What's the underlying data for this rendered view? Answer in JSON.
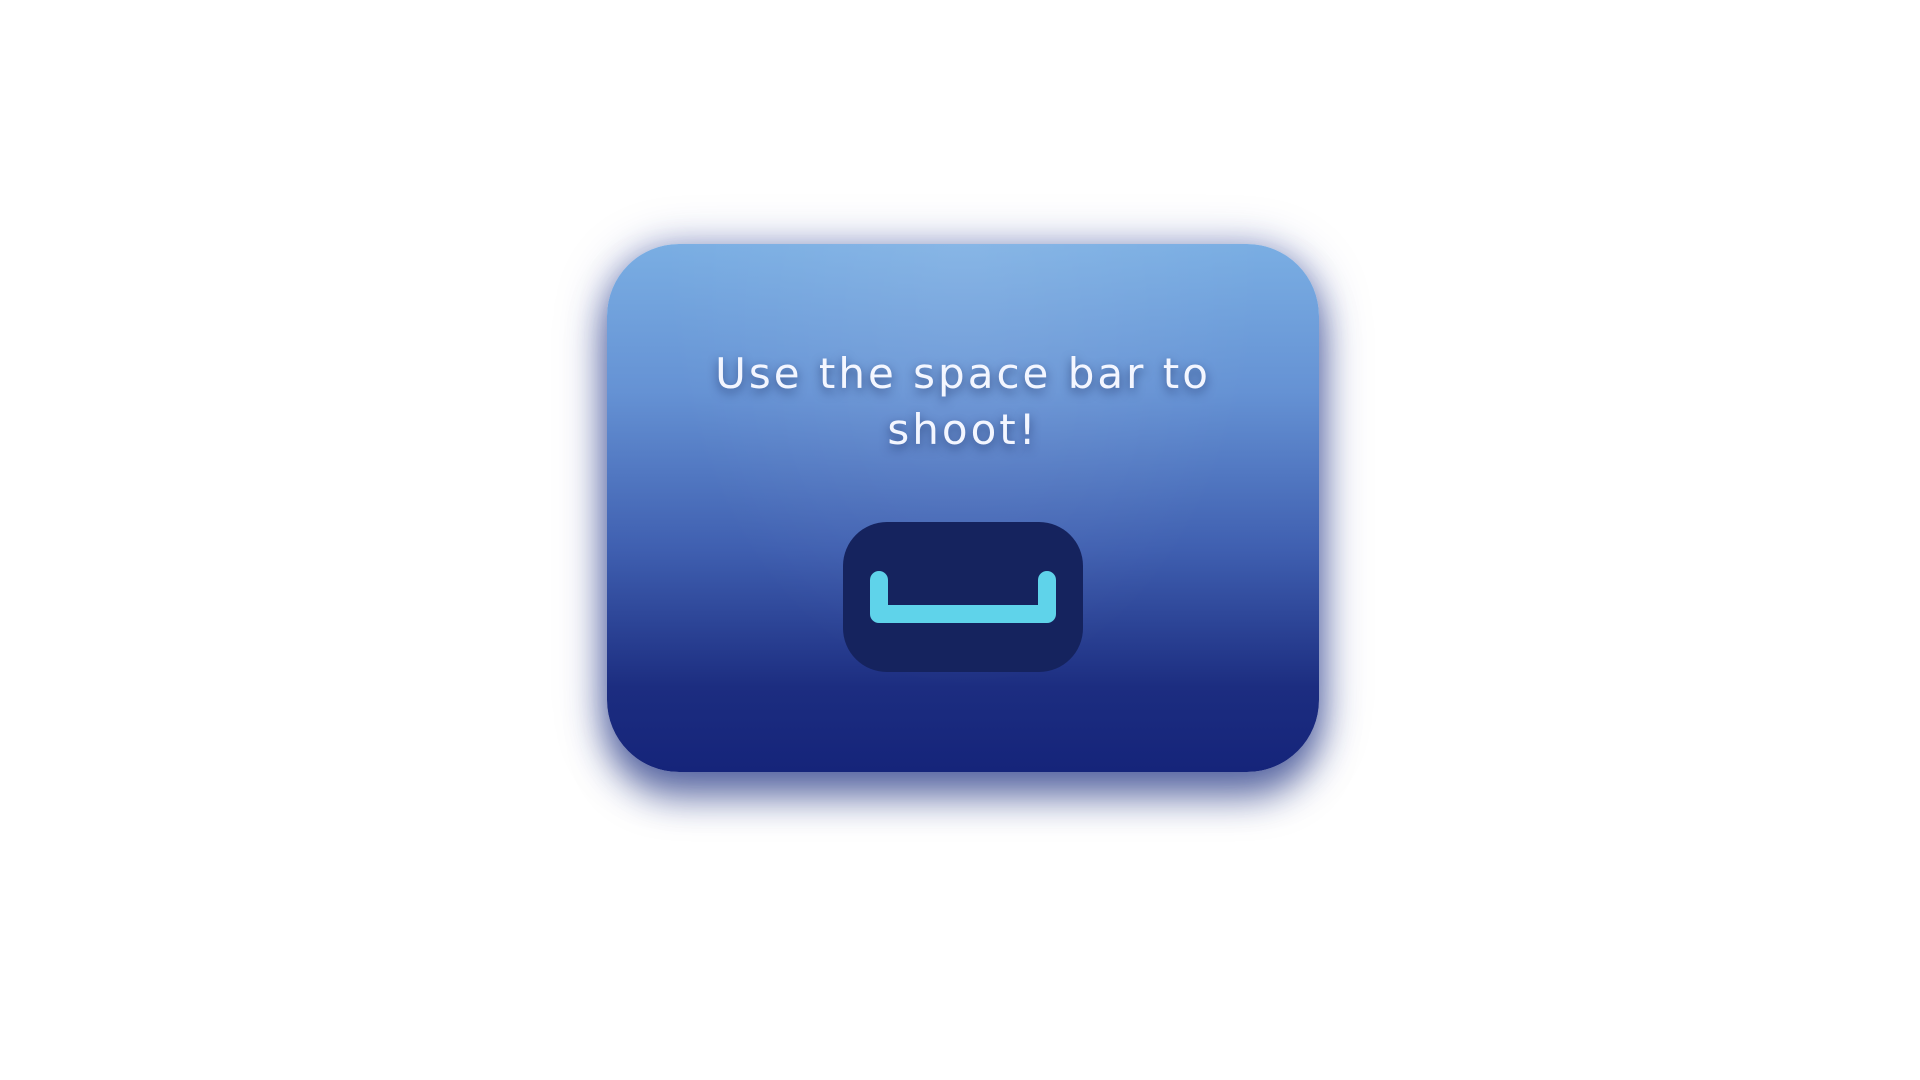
{
  "overlay": {
    "instruction_text": "Use the space bar to shoot!",
    "key_icon": "space-bar-key-icon"
  },
  "colors": {
    "page_background": "#ffffff",
    "card_gradient_top": "#7aaee3",
    "card_gradient_bottom": "#15247a",
    "key_background": "#15235e",
    "key_symbol": "#5fd3ea",
    "text": "#f3f6ff"
  }
}
